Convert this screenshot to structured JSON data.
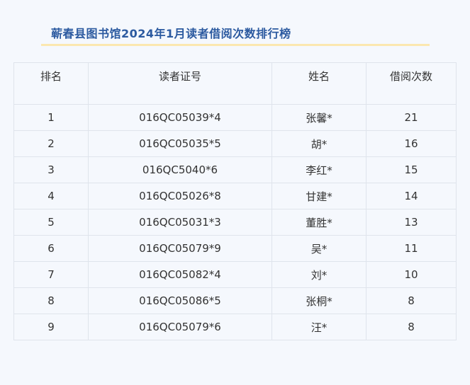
{
  "header": {
    "title": "蕲春县图书馆2024年1月读者借阅次数排行榜"
  },
  "table": {
    "columns": [
      "排名",
      "读者证号",
      "姓名",
      "借阅次数"
    ],
    "rows": [
      {
        "rank": "1",
        "card": "016QC05039*4",
        "name": "张馨*",
        "count": "21"
      },
      {
        "rank": "2",
        "card": "016QC05035*5",
        "name": "胡*",
        "count": "16"
      },
      {
        "rank": "3",
        "card": "016QC5040*6",
        "name": "李红*",
        "count": "15"
      },
      {
        "rank": "4",
        "card": "016QC05026*8",
        "name": "甘建*",
        "count": "14"
      },
      {
        "rank": "5",
        "card": "016QC05031*3",
        "name": "董胜*",
        "count": "13"
      },
      {
        "rank": "6",
        "card": "016QC05079*9",
        "name": "吴*",
        "count": "11"
      },
      {
        "rank": "7",
        "card": "016QC05082*4",
        "name": "刘*",
        "count": "10"
      },
      {
        "rank": "8",
        "card": "016QC05086*5",
        "name": "张桐*",
        "count": "8"
      },
      {
        "rank": "9",
        "card": "016QC05079*6",
        "name": "汪*",
        "count": "8"
      }
    ]
  },
  "colors": {
    "title": "#2c5aa0",
    "title_underline": "#fbe7b0",
    "background": "#f5f8fd",
    "border": "#dfe4ec",
    "text": "#333333"
  }
}
